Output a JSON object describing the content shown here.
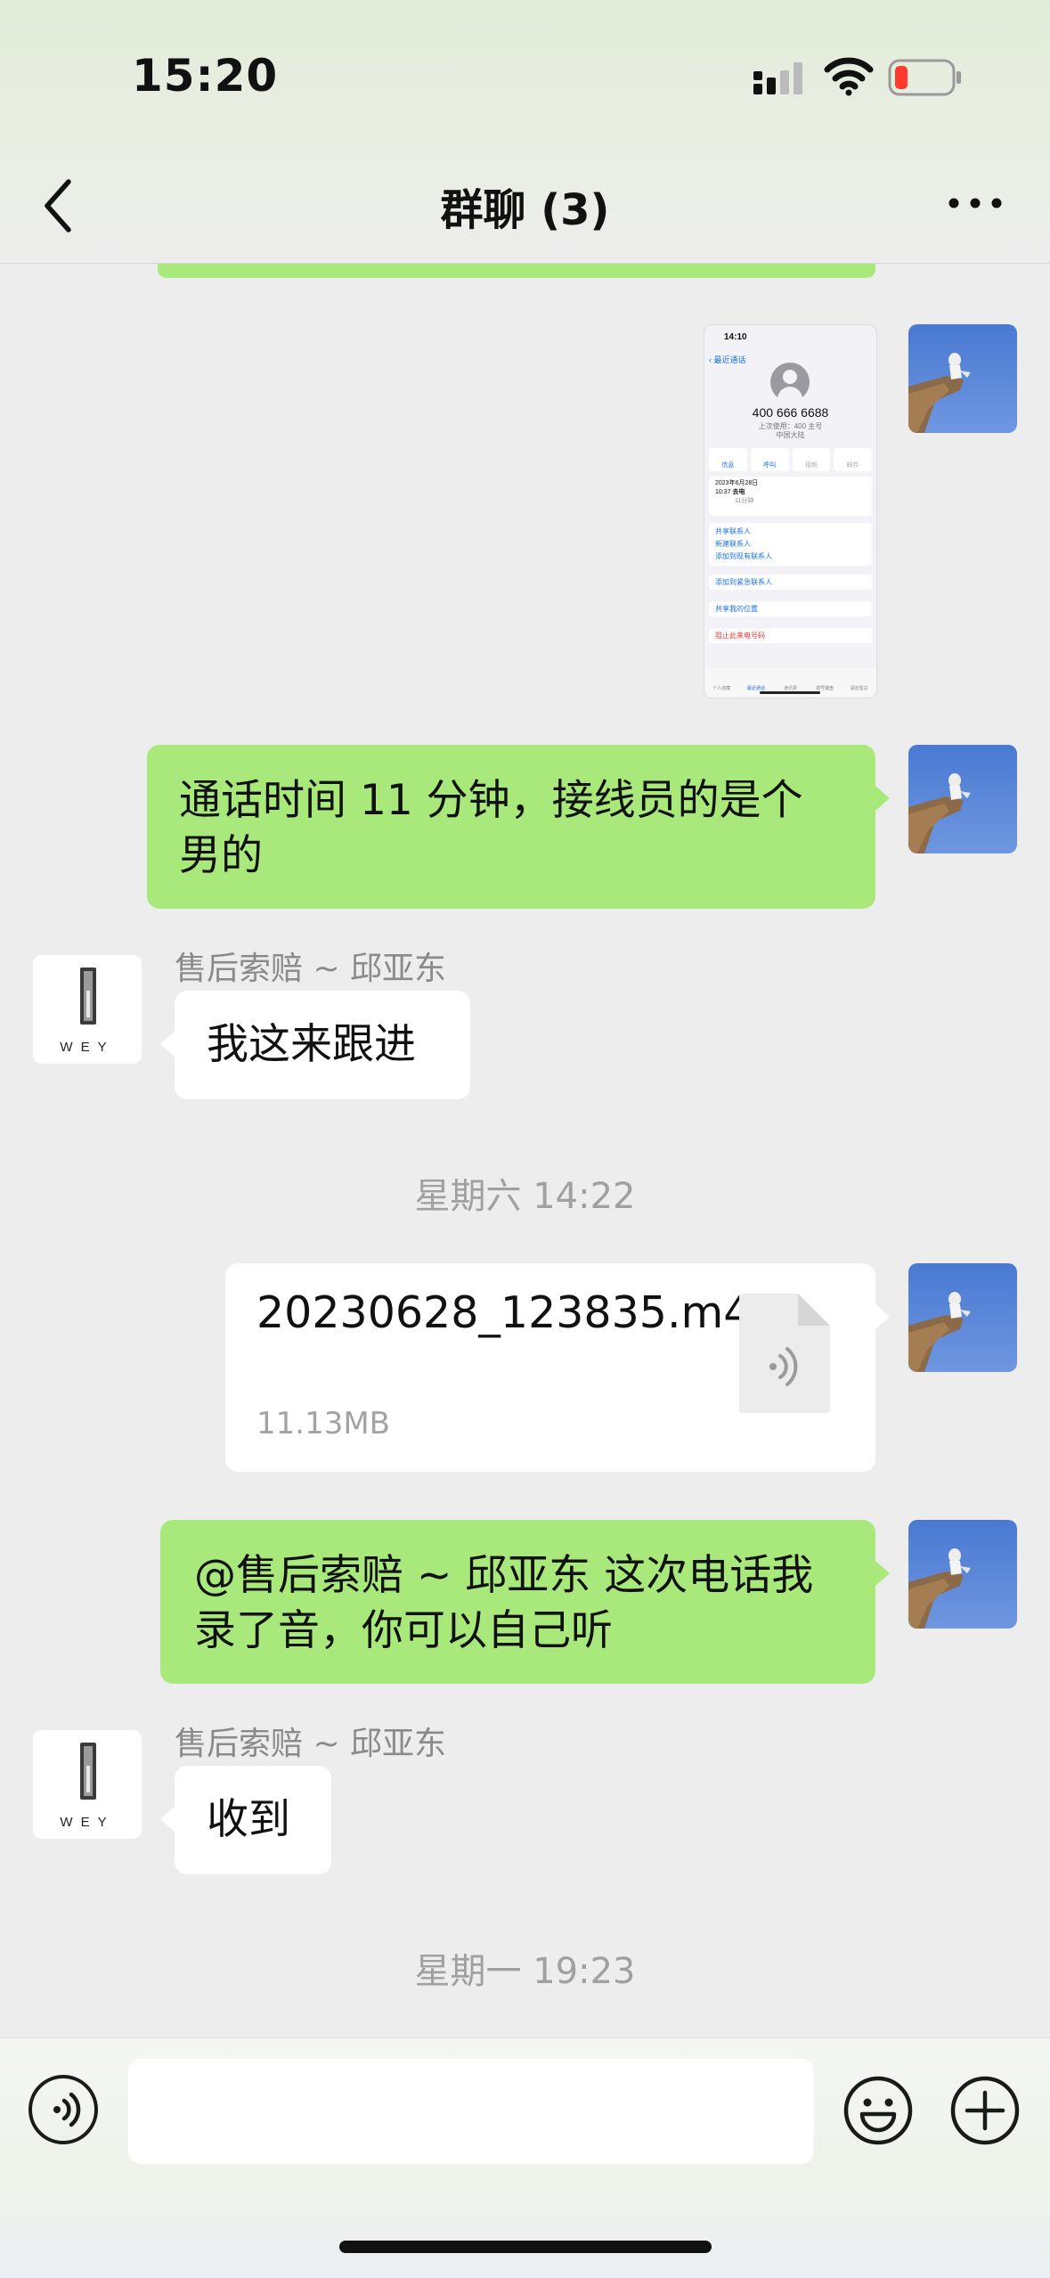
{
  "status_bar": {
    "time": "15:20"
  },
  "nav": {
    "title": "群聊 (3)"
  },
  "screenshot_thumb": {
    "time": "14:10",
    "back": "最近通话",
    "number": "400 666 6688",
    "last_used": "上次使用：400 主号",
    "region": "中国大陆",
    "actions": [
      "信息",
      "呼叫",
      "视频",
      "邮件"
    ],
    "call_date": "2023年6月28日",
    "call_time": "10:37",
    "call_type": "去电",
    "call_duration": "11分钟",
    "menu1": [
      "共享联系人",
      "新建联系人",
      "添加到现有联系人"
    ],
    "menu2": "添加到紧急联系人",
    "menu3": "共享我的位置",
    "block": "阻止此来电号码",
    "tabs": [
      "个人收藏",
      "最近通话",
      "通讯录",
      "拨号键盘",
      "语音留言"
    ]
  },
  "messages": {
    "m1": "通话时间 11 分钟，接线员的是个男的",
    "sender1": "售后索赔 ~ 邱亚东",
    "m2": "我这来跟进",
    "stamp1": "星期六 14:22",
    "file_name": "20230628_123835.m4a",
    "file_size": "11.13MB",
    "m3": "@售后索赔 ~ 邱亚东 这次电话我录了音，你可以自己听",
    "sender2": "售后索赔 ~ 邱亚东",
    "m4": "收到",
    "stamp2": "星期一 19:23"
  },
  "avatar_logo": "WEY",
  "input": {
    "value": ""
  },
  "icons": {
    "back": "chevron-left-icon",
    "more": "more-icon",
    "voice": "voice-icon",
    "emoji": "emoji-icon",
    "plus": "plus-icon",
    "file": "audio-file-icon"
  },
  "colors": {
    "bubble_me": "#a9e97c",
    "bubble_other": "#ffffff",
    "background": "#ededed"
  }
}
